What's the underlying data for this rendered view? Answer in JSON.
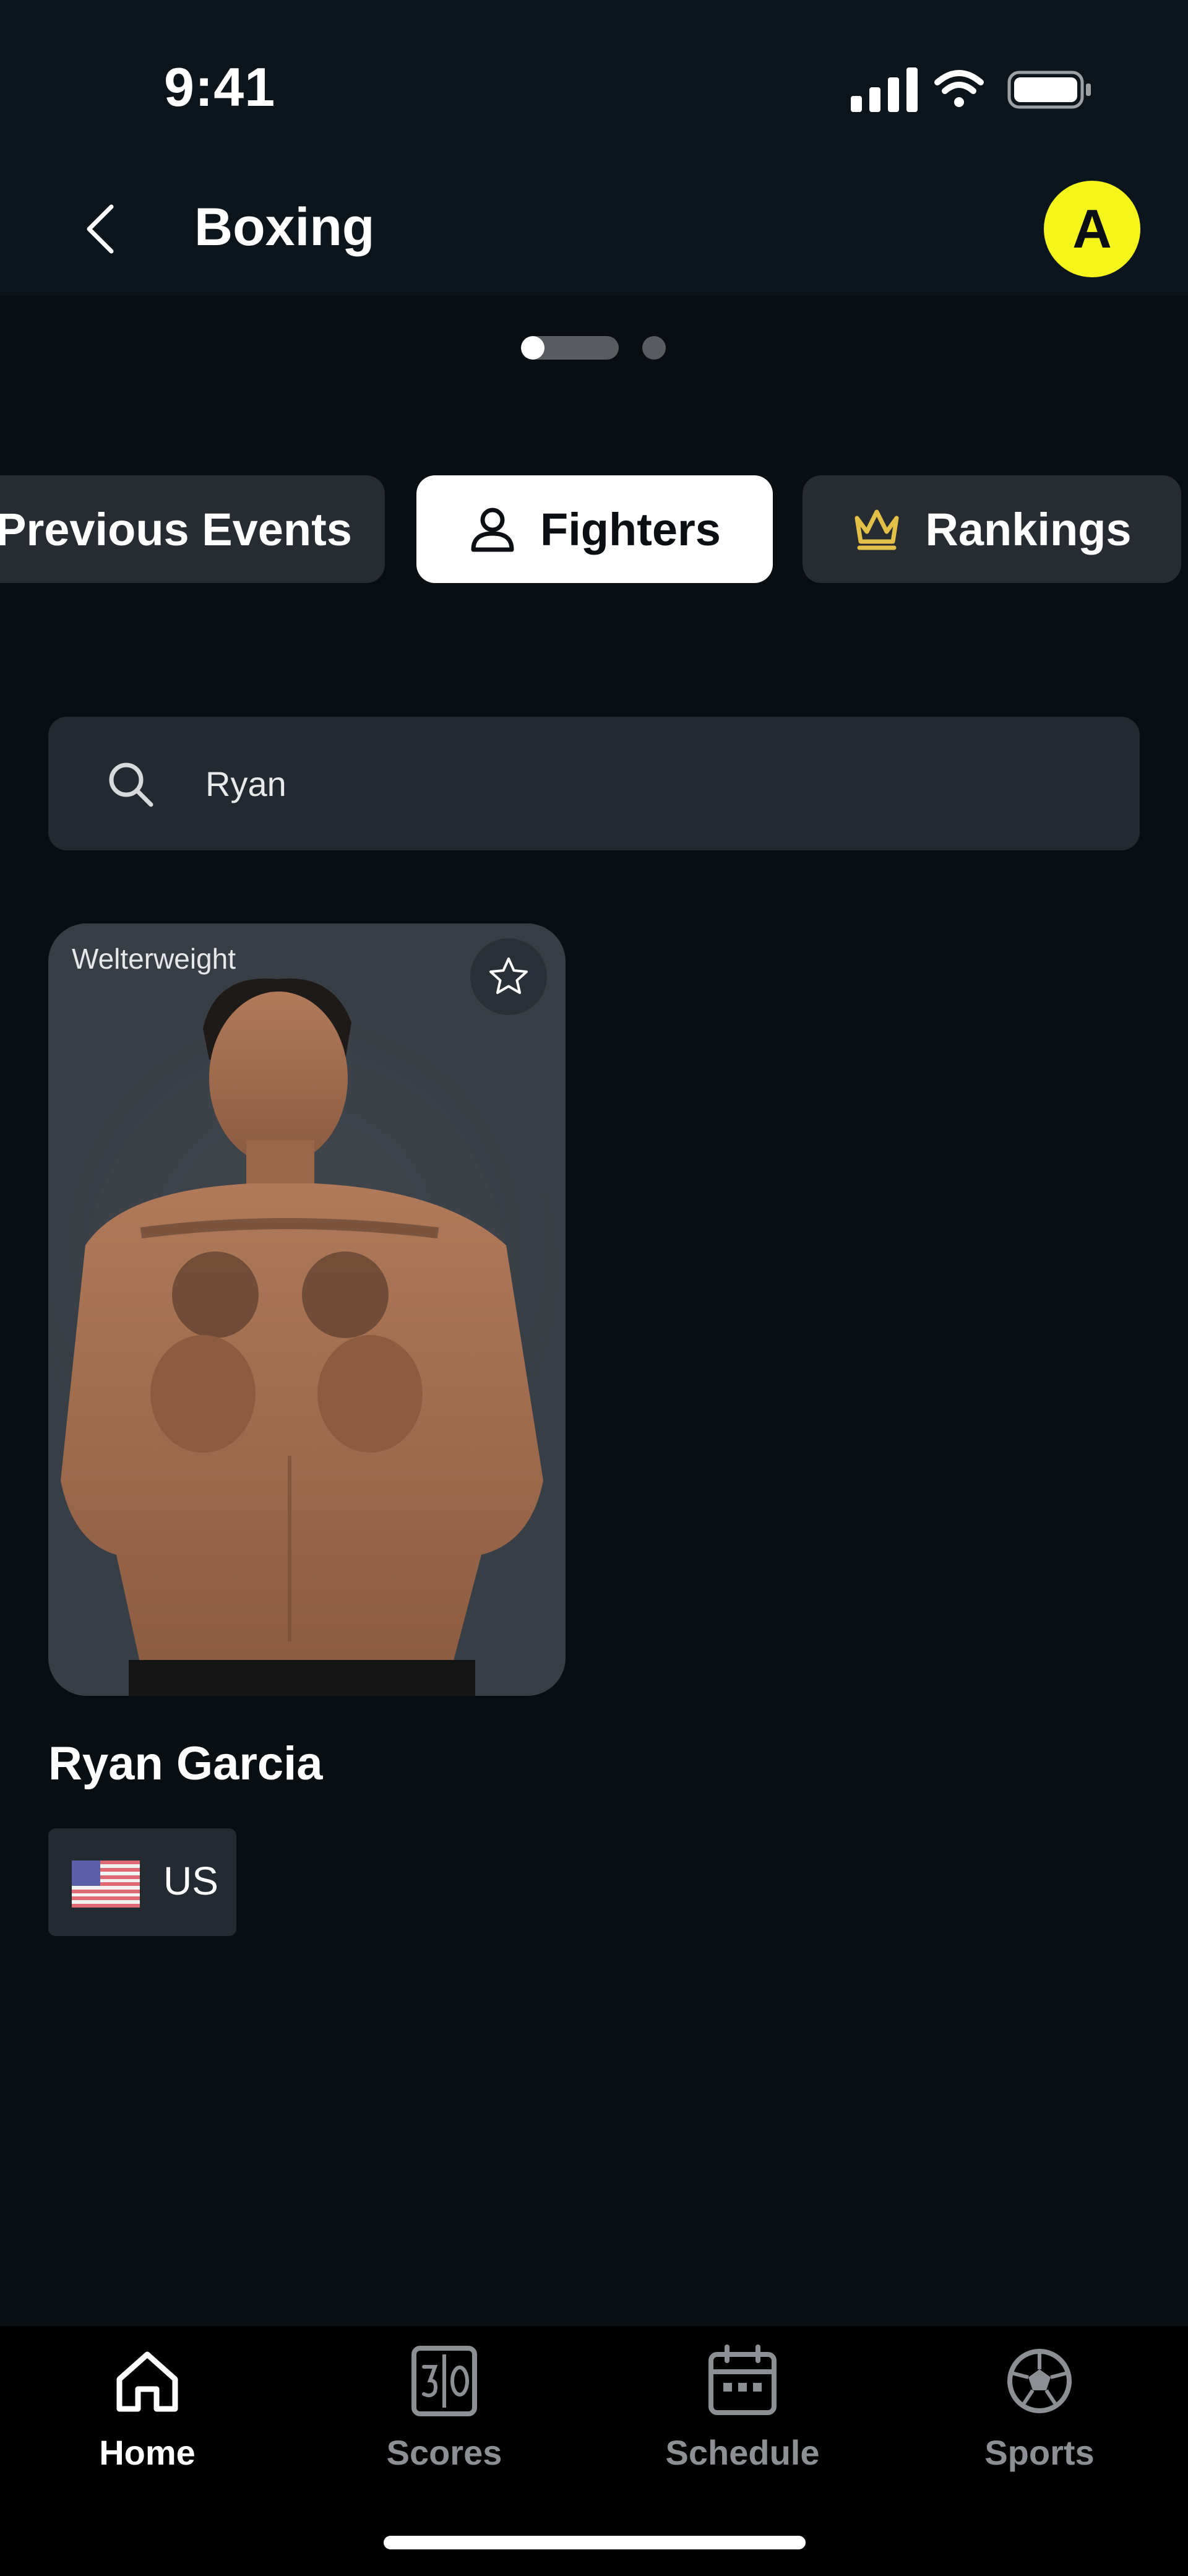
{
  "status_bar": {
    "time": "9:41",
    "icons": [
      "signal-icon",
      "wifi-icon",
      "battery-icon"
    ]
  },
  "header": {
    "back_icon": "chevron-left-icon",
    "title": "Boxing",
    "avatar_initial": "A",
    "avatar_color": "#f6f51b"
  },
  "pager": {
    "pages": 2,
    "active_index": 0
  },
  "tabs": [
    {
      "label": "Previous Events",
      "icon": null,
      "active": false
    },
    {
      "label": "Fighters",
      "icon": "person-icon",
      "active": true
    },
    {
      "label": "Rankings",
      "icon": "crown-icon",
      "active": false,
      "icon_color": "#e2c048"
    }
  ],
  "search": {
    "icon": "search-icon",
    "value": "Ryan"
  },
  "results": [
    {
      "weight_class": "Welterweight",
      "favorite_icon": "star-outline-icon",
      "name": "Ryan Garcia",
      "country_code": "US",
      "flag_icon": "us-flag-icon"
    }
  ],
  "bottom_nav": [
    {
      "label": "Home",
      "icon": "home-icon",
      "active": true
    },
    {
      "label": "Scores",
      "icon": "scoreboard-icon",
      "active": false
    },
    {
      "label": "Schedule",
      "icon": "calendar-icon",
      "active": false
    },
    {
      "label": "Sports",
      "icon": "soccer-ball-icon",
      "active": false
    }
  ],
  "colors": {
    "background": "#090e12",
    "header_bg": "#0d151c",
    "surface": "#272c33",
    "active_tab_bg": "#ffffff",
    "accent_yellow": "#f6f51b",
    "inactive_nav": "#8c9095"
  }
}
